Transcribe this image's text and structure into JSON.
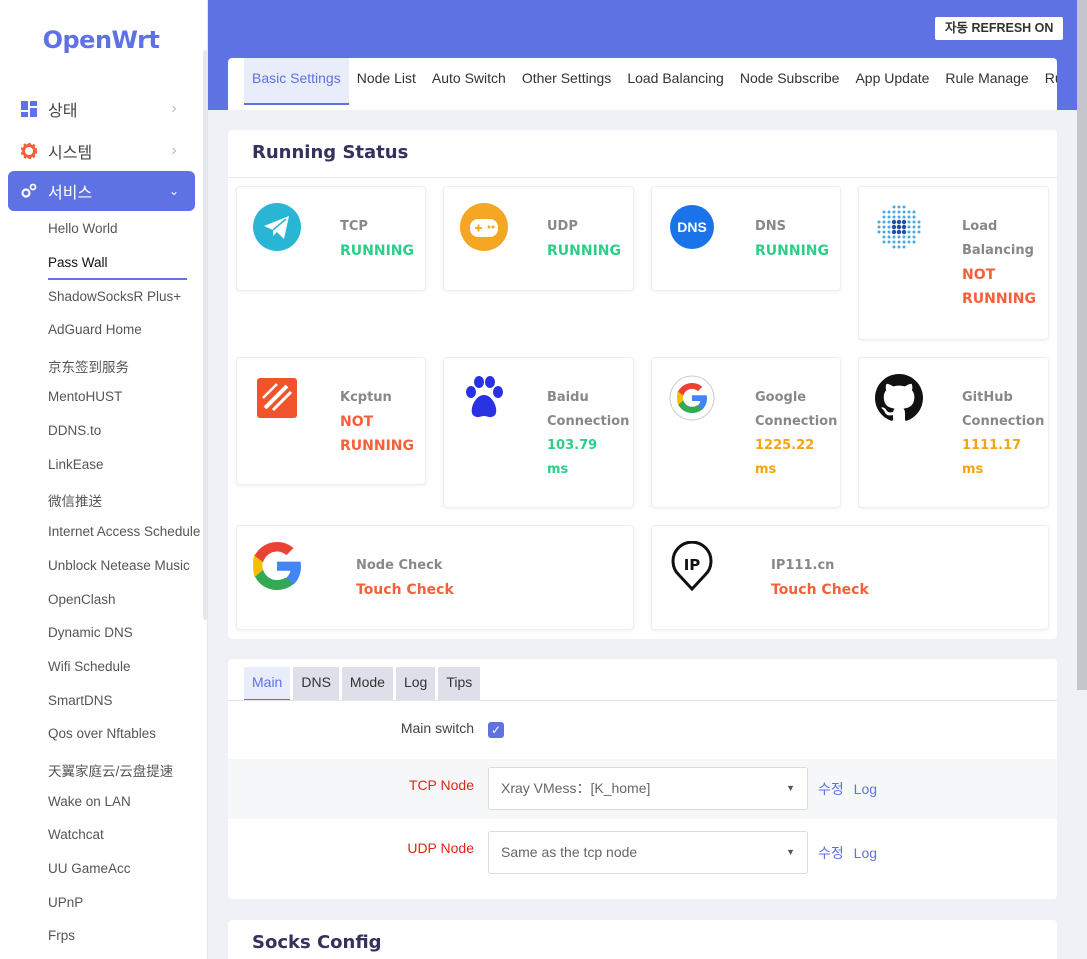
{
  "brand": "OpenWrt",
  "refresh_label": "자동 REFRESH ON",
  "menu": {
    "status": "상태",
    "system": "시스템",
    "services": "서비스"
  },
  "services_items": [
    "Hello World",
    "Pass Wall",
    "ShadowSocksR Plus+",
    "AdGuard Home",
    "京东签到服务",
    "MentoHUST",
    "DDNS.to",
    "LinkEase",
    "微信推送",
    "Internet Access Schedule",
    "Unblock Netease Music",
    "OpenClash",
    "Dynamic DNS",
    "Wifi Schedule",
    "SmartDNS",
    "Qos over Nftables",
    "天翼家庭云/云盘提速",
    "Wake on LAN",
    "Watchcat",
    "UU GameAcc",
    "UPnP",
    "Frps"
  ],
  "tabs": [
    "Basic Settings",
    "Node List",
    "Auto Switch",
    "Other Settings",
    "Load Balancing",
    "Node Subscribe",
    "App Update",
    "Rule Manage",
    "Ru"
  ],
  "running_status": {
    "title": "Running Status",
    "tcp": {
      "label": "TCP",
      "status": "RUNNING"
    },
    "udp": {
      "label": "UDP",
      "status": "RUNNING"
    },
    "dns": {
      "label": "DNS",
      "status": "RUNNING",
      "icon_text": "DNS"
    },
    "lb": {
      "label1": "Load",
      "label2": "Balancing",
      "status1": "NOT",
      "status2": "RUNNING"
    },
    "kcptun": {
      "label": "Kcptun",
      "status1": "NOT",
      "status2": "RUNNING"
    },
    "baidu": {
      "label1": "Baidu",
      "label2": "Connection",
      "value": "103.79",
      "unit": "ms"
    },
    "google": {
      "label1": "Google",
      "label2": "Connection",
      "value": "1225.22",
      "unit": "ms"
    },
    "github": {
      "label1": "GitHub",
      "label2": "Connection",
      "value": "1111.17",
      "unit": "ms"
    },
    "node_check": {
      "label": "Node Check",
      "action": "Touch Check"
    },
    "ip111": {
      "label": "IP111.cn",
      "action": "Touch Check",
      "icon_text": "IP"
    }
  },
  "subtabs": [
    "Main",
    "DNS",
    "Mode",
    "Log",
    "Tips"
  ],
  "form": {
    "main_switch_label": "Main switch",
    "main_switch_checked": true,
    "tcp_node_label": "TCP Node",
    "tcp_node_value": "Xray VMess：[K_home]",
    "udp_node_label": "UDP Node",
    "udp_node_value": "Same as the tcp node",
    "edit_link": "수정",
    "log_link": "Log"
  },
  "socks_title": "Socks Config",
  "colors": {
    "accent": "#5e72e4",
    "running": "#2dce89",
    "not_running": "#f5603b",
    "latency": "#f5a30f"
  }
}
